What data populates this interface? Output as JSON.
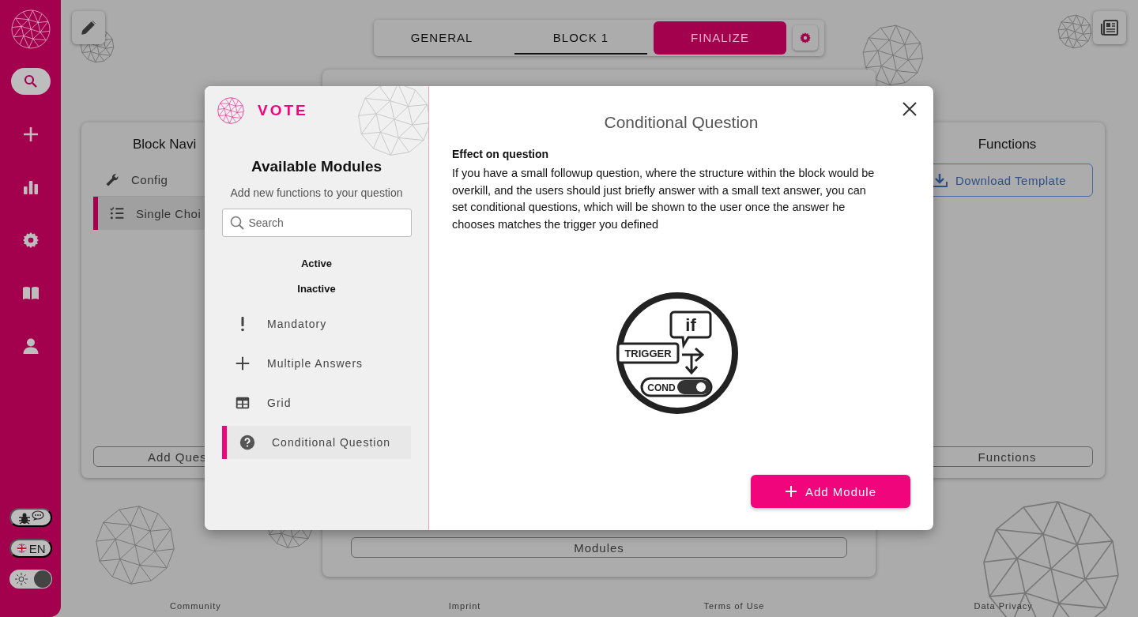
{
  "sidebar": {
    "items": [
      {
        "kind": "search",
        "selected": true
      },
      {
        "kind": "add",
        "selected": false
      },
      {
        "kind": "stats",
        "selected": false
      },
      {
        "kind": "settings",
        "selected": false
      },
      {
        "kind": "docs",
        "selected": false
      },
      {
        "kind": "profile",
        "selected": false
      }
    ],
    "language": "EN",
    "theme_toggle": {
      "on": true
    }
  },
  "tabs": [
    {
      "label": "GENERAL",
      "selected": false,
      "kind": "tab"
    },
    {
      "label": "BLOCK 1",
      "selected": true,
      "kind": "tab"
    },
    {
      "label": "FINALIZE",
      "selected": false,
      "kind": "action"
    }
  ],
  "block_panel": {
    "title": "Block Navi",
    "items": [
      {
        "label": "Config",
        "kind": "config",
        "selected": false
      },
      {
        "label": "Single Choi",
        "kind": "question",
        "selected": true
      }
    ],
    "button": "Add Ques"
  },
  "modules_panel": {
    "button": "Modules"
  },
  "functions_panel": {
    "title": "Functions",
    "download": "Download Template",
    "button": "Functions"
  },
  "modal": {
    "brand": "VOTE",
    "title": "Available Modules",
    "subtitle": "Add new functions to your question",
    "search": {
      "placeholder": "Search"
    },
    "sections": [
      "Active",
      "Inactive"
    ],
    "modules": [
      {
        "label": "Mandatory",
        "kind": "mandatory",
        "selected": false
      },
      {
        "label": "Multiple Answers",
        "kind": "multiple",
        "selected": false
      },
      {
        "label": "Grid",
        "kind": "grid",
        "selected": false
      },
      {
        "label": "Conditional Question",
        "kind": "conditional",
        "selected": true
      }
    ],
    "detail": {
      "title": "Conditional Question",
      "heading": "Effect on question",
      "text": "If you have a small followup question, where the structure within the block would be overkill, and the users should just briefly answer with a small text answer, you can set conditional questions, which will be shown to the user once the answer he chooses matches the trigger you defined",
      "illustration": {
        "labels": [
          "if",
          "TRIGGER",
          "COND"
        ]
      },
      "button": "Add Module"
    }
  },
  "footer": [
    "Community",
    "Imprint",
    "Terms of Use",
    "Data Privacy"
  ]
}
